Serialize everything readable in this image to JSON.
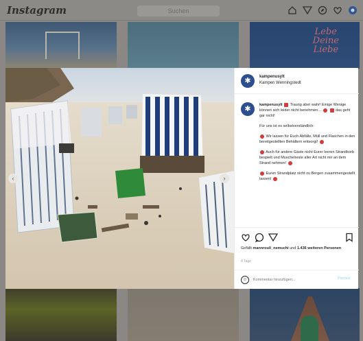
{
  "app": {
    "logo": "Instagram",
    "search_placeholder": "Suchen"
  },
  "nav_icons": [
    "home-icon",
    "direct-icon",
    "explore-icon",
    "activity-icon",
    "profile-icon"
  ],
  "grid": {
    "tile3_quote_lines": [
      "Lebe",
      "Deine",
      "Liebe"
    ]
  },
  "post": {
    "username": "kampenusylt",
    "location": "Kampen Wenningstedt",
    "caption": {
      "author": "kampenusylt",
      "para1": "Traurig aber wahr! Einige Wenige können sich leider nicht benehmen…",
      "para1_tail": "das geht gar nicht!",
      "para2": "Für uns ist es selbstverständlich:",
      "para3": "Wir lassen für Euch Abfälle, Müll und Flaschen in den bereitgestellten Behältern entsorgt!",
      "para4": "Auch für andere Gäste nicht Eurer leeren Strandkorb bespielt und Muschelreste aller Art nicht mir an dem Strand nehmen!",
      "para5": "Euren Strandplatz nicht zu Bergen zusammengestellt lassen!"
    },
    "likes_prefix": "Gefällt",
    "likes_user": "mannrouli_nemuchi",
    "likes_mid": "und",
    "likes_count": "1.436 weiteren Personen",
    "date": "4 Tage",
    "comment_placeholder": "Kommentar hinzufügen...",
    "post_button": "Posten"
  },
  "colors": {
    "accent": "#2e4f8f",
    "link": "#b2dffc",
    "heart": "#d23c3c"
  }
}
